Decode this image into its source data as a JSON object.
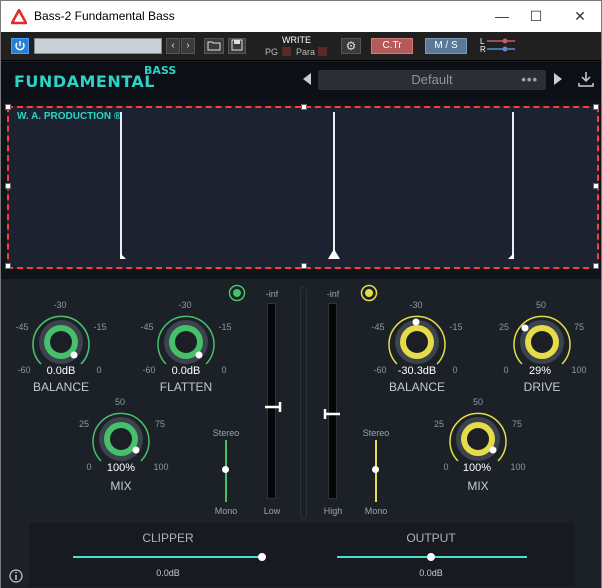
{
  "window": {
    "title": "Bass-2 Fundamental Bass",
    "minimize": "—",
    "maximize": "☐",
    "close": "✕"
  },
  "host": {
    "preset_field": "",
    "write_label": "WRITE",
    "pg_label": "PG",
    "para_label": "Para",
    "ctr_label": "C.Tr",
    "ms_label": "M / S",
    "l_label": "L",
    "r_label": "R"
  },
  "header": {
    "brand": "FUNDAMENTAL",
    "brand_sup": "BASS",
    "preset": "Default",
    "preset_menu": "•••"
  },
  "display": {
    "watermark": "W. A. PRODUCTION ®"
  },
  "left": {
    "balance": {
      "label": "BALANCE",
      "value": "0.0dB",
      "ticks": {
        "top": "-30",
        "l1": "-45",
        "r1": "-15",
        "l2": "-60",
        "r2": "0"
      }
    },
    "flatten": {
      "label": "FLATTEN",
      "value": "0.0dB",
      "ticks": {
        "top": "-30",
        "l1": "-45",
        "r1": "-15",
        "l2": "-60",
        "r2": "0"
      }
    },
    "mix": {
      "label": "MIX",
      "value": "100%",
      "ticks": {
        "top": "50",
        "l1": "25",
        "r1": "75",
        "l2": "0",
        "r2": "100"
      }
    },
    "stereo_top": "Stereo",
    "stereo_bottom": "Mono"
  },
  "center": {
    "low_top": "-inf",
    "low_label": "Low",
    "high_top": "-inf",
    "high_label": "High"
  },
  "right": {
    "balance": {
      "label": "BALANCE",
      "value": "-30.3dB",
      "ticks": {
        "top": "-30",
        "l1": "-45",
        "r1": "-15",
        "l2": "-60",
        "r2": "0"
      }
    },
    "drive": {
      "label": "DRIVE",
      "value": "29%",
      "ticks": {
        "top": "50",
        "l1": "25",
        "r1": "75",
        "l2": "0",
        "r2": "100"
      }
    },
    "mix": {
      "label": "MIX",
      "value": "100%",
      "ticks": {
        "top": "50",
        "l1": "25",
        "r1": "75",
        "l2": "0",
        "r2": "100"
      }
    },
    "stereo_top": "Stereo",
    "stereo_bottom": "Mono"
  },
  "bottom": {
    "clipper": {
      "label": "CLIPPER",
      "value": "0.0dB"
    },
    "output": {
      "label": "OUTPUT",
      "value": "0.0dB"
    }
  },
  "colors": {
    "teal": "#2ed3c4",
    "green": "#46c06a",
    "yellow": "#e6dc4a",
    "red": "#ff3b3b"
  }
}
